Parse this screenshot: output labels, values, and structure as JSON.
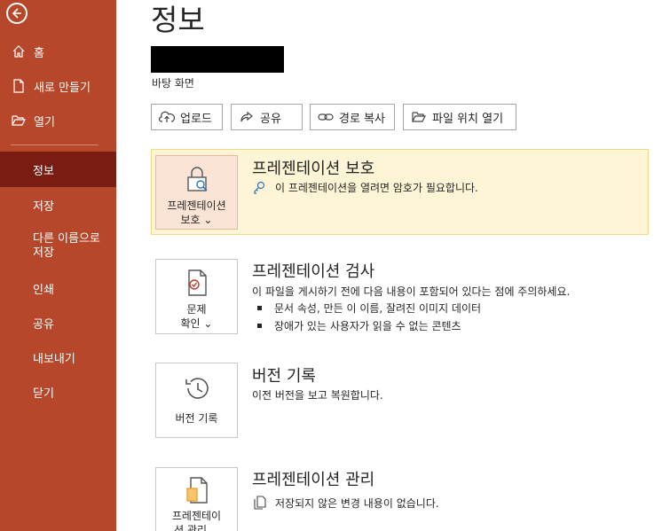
{
  "sidebar": {
    "items": [
      {
        "label": "홈",
        "icon": "home-icon"
      },
      {
        "label": "새로 만들기",
        "icon": "new-document-icon"
      },
      {
        "label": "열기",
        "icon": "folder-open-icon"
      },
      {
        "label": "정보"
      },
      {
        "label": "저장"
      },
      {
        "label": "다른 이름으로 저장"
      },
      {
        "label": "인쇄"
      },
      {
        "label": "공유"
      },
      {
        "label": "내보내기"
      },
      {
        "label": "닫기"
      }
    ],
    "selected": "정보"
  },
  "page": {
    "title": "정보",
    "location": "바탕 화면"
  },
  "toolbar": {
    "upload": "업로드",
    "share": "공유",
    "copy_path": "경로 복사",
    "open_location": "파일 위치 열기"
  },
  "protect": {
    "button_line1": "프레젠테이션",
    "button_line2": "보호 ⌄",
    "title": "프레젠테이션 보호",
    "desc": "이 프레젠테이션을 열려면 암호가 필요합니다."
  },
  "inspect": {
    "button_line1": "문제",
    "button_line2": "확인 ⌄",
    "title": "프레젠테이션 검사",
    "desc": "이 파일을 게시하기 전에 다음 내용이 포함되어 있다는 점에 주의하세요.",
    "bullets": [
      "문서 속성, 만든 이 이름, 잘려진 이미지 데이터",
      "장애가 있는 사용자가 읽을 수 없는 콘텐츠"
    ]
  },
  "history": {
    "button_label": "버전 기록",
    "title": "버전 기록",
    "desc": "이전 버전을 보고 복원합니다."
  },
  "manage": {
    "button_line1": "프레젠테이",
    "button_line2": "션 관리 ⌄",
    "title": "프레젠테이션 관리",
    "desc": "저장되지 않은 변경 내용이 없습니다."
  },
  "colors": {
    "sidebar": "#b7472a",
    "sidebar_selected": "#7a1c12",
    "protect_bg": "#fdf5d6",
    "protect_button_bg": "#fbe3d6"
  }
}
